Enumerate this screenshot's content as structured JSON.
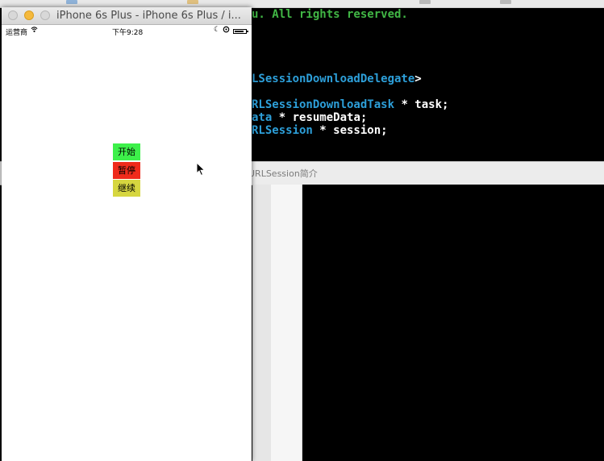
{
  "editor": {
    "code_lines": [
      {
        "parts": [
          {
            "text": "u. All rights reserved.",
            "color": "green"
          }
        ]
      },
      {
        "parts": [
          {
            "text": "LSessionDownloadDelegate",
            "color": "blue"
          },
          {
            "text": ">",
            "color": "white"
          }
        ]
      },
      {
        "parts": [
          {
            "text": "RLSessionDownloadTask",
            "color": "blue"
          },
          {
            "text": " * task;",
            "color": "white"
          }
        ]
      },
      {
        "parts": [
          {
            "text": "ata",
            "color": "blue"
          },
          {
            "text": " * resumeData;",
            "color": "white"
          }
        ]
      },
      {
        "parts": [
          {
            "text": "RLSession",
            "color": "blue"
          },
          {
            "text": " * session;",
            "color": "white"
          }
        ]
      }
    ],
    "tab_label": "URLSession简介"
  },
  "simulator": {
    "title": "iPhone 6s Plus - iPhone 6s Plus / i...",
    "status_bar": {
      "carrier": "运营商",
      "time": "下午9:28",
      "battery_level": 0.85
    },
    "buttons": {
      "start": "开始",
      "pause": "暂停",
      "resume": "继续"
    }
  },
  "colors": {
    "green": "#41b645",
    "blue": "#2d9fd9",
    "white": "#ffffff",
    "start_button": "#3df04a",
    "pause_button": "#ef2b1b",
    "resume_button": "#d6d640"
  },
  "icons": [
    "wifi-icon",
    "moon-icon",
    "lock-icon",
    "battery-icon",
    "cursor-icon"
  ]
}
